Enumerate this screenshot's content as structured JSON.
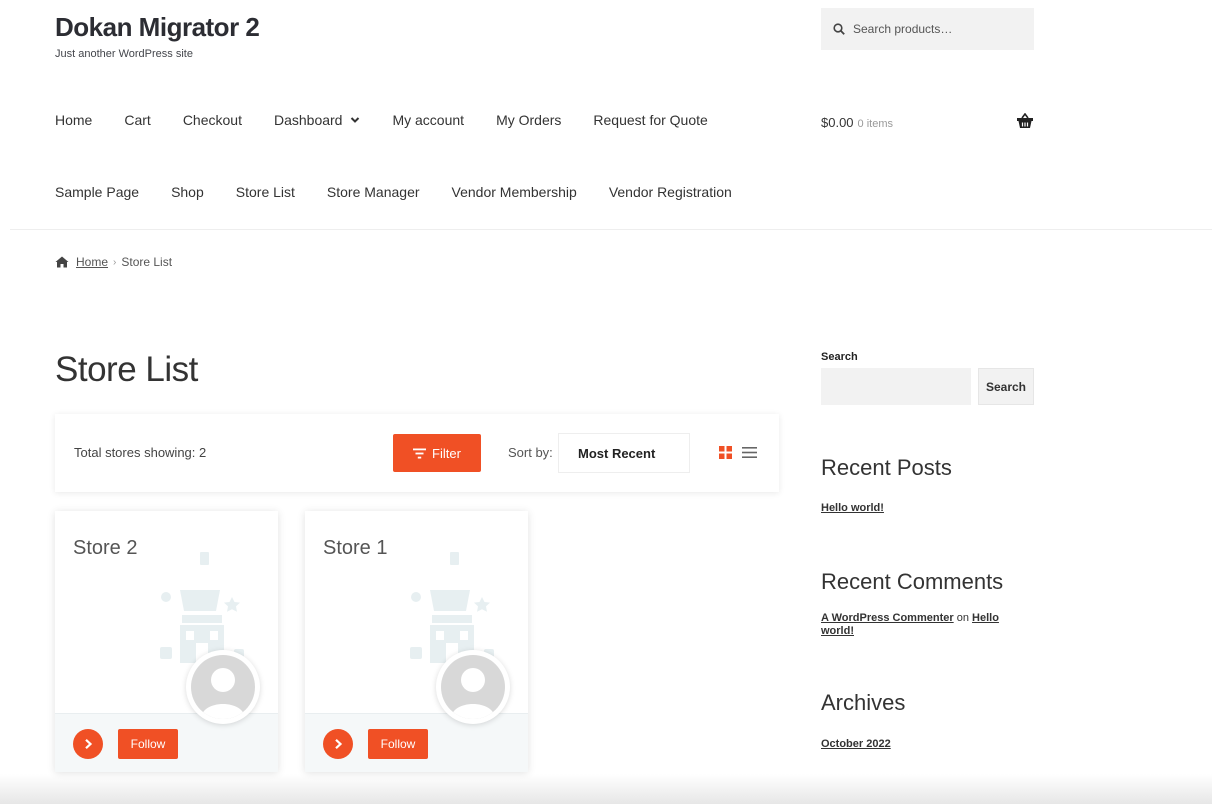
{
  "site": {
    "title": "Dokan Migrator 2",
    "tagline": "Just another WordPress site"
  },
  "header": {
    "search_placeholder": "Search products…",
    "cart_total": "$0.00",
    "cart_items": "0 items"
  },
  "nav": {
    "row1": [
      "Home",
      "Cart",
      "Checkout",
      "Dashboard",
      "My account",
      "My Orders",
      "Request for Quote"
    ],
    "row2": [
      "Sample Page",
      "Shop",
      "Store List",
      "Store Manager",
      "Vendor Membership",
      "Vendor Registration"
    ]
  },
  "breadcrumb": {
    "home": "Home",
    "separator": "›",
    "current": "Store List"
  },
  "page": {
    "title": "Store List"
  },
  "toolbar": {
    "total_text": "Total stores showing: 2",
    "filter_label": "Filter",
    "sort_label": "Sort by:",
    "sort_value": "Most Recent"
  },
  "stores": [
    {
      "name": "Store 2",
      "follow_label": "Follow"
    },
    {
      "name": "Store 1",
      "follow_label": "Follow"
    }
  ],
  "sidebar": {
    "search_title": "Search",
    "search_button": "Search",
    "recent_posts_title": "Recent Posts",
    "recent_post_1": "Hello world!",
    "recent_comments_title": "Recent Comments",
    "comment_author": "A WordPress Commenter",
    "comment_on": "on",
    "comment_post": "Hello world!",
    "archives_title": "Archives",
    "archive_1": "October 2022"
  },
  "colors": {
    "accent": "#f05025",
    "text": "#333333"
  }
}
